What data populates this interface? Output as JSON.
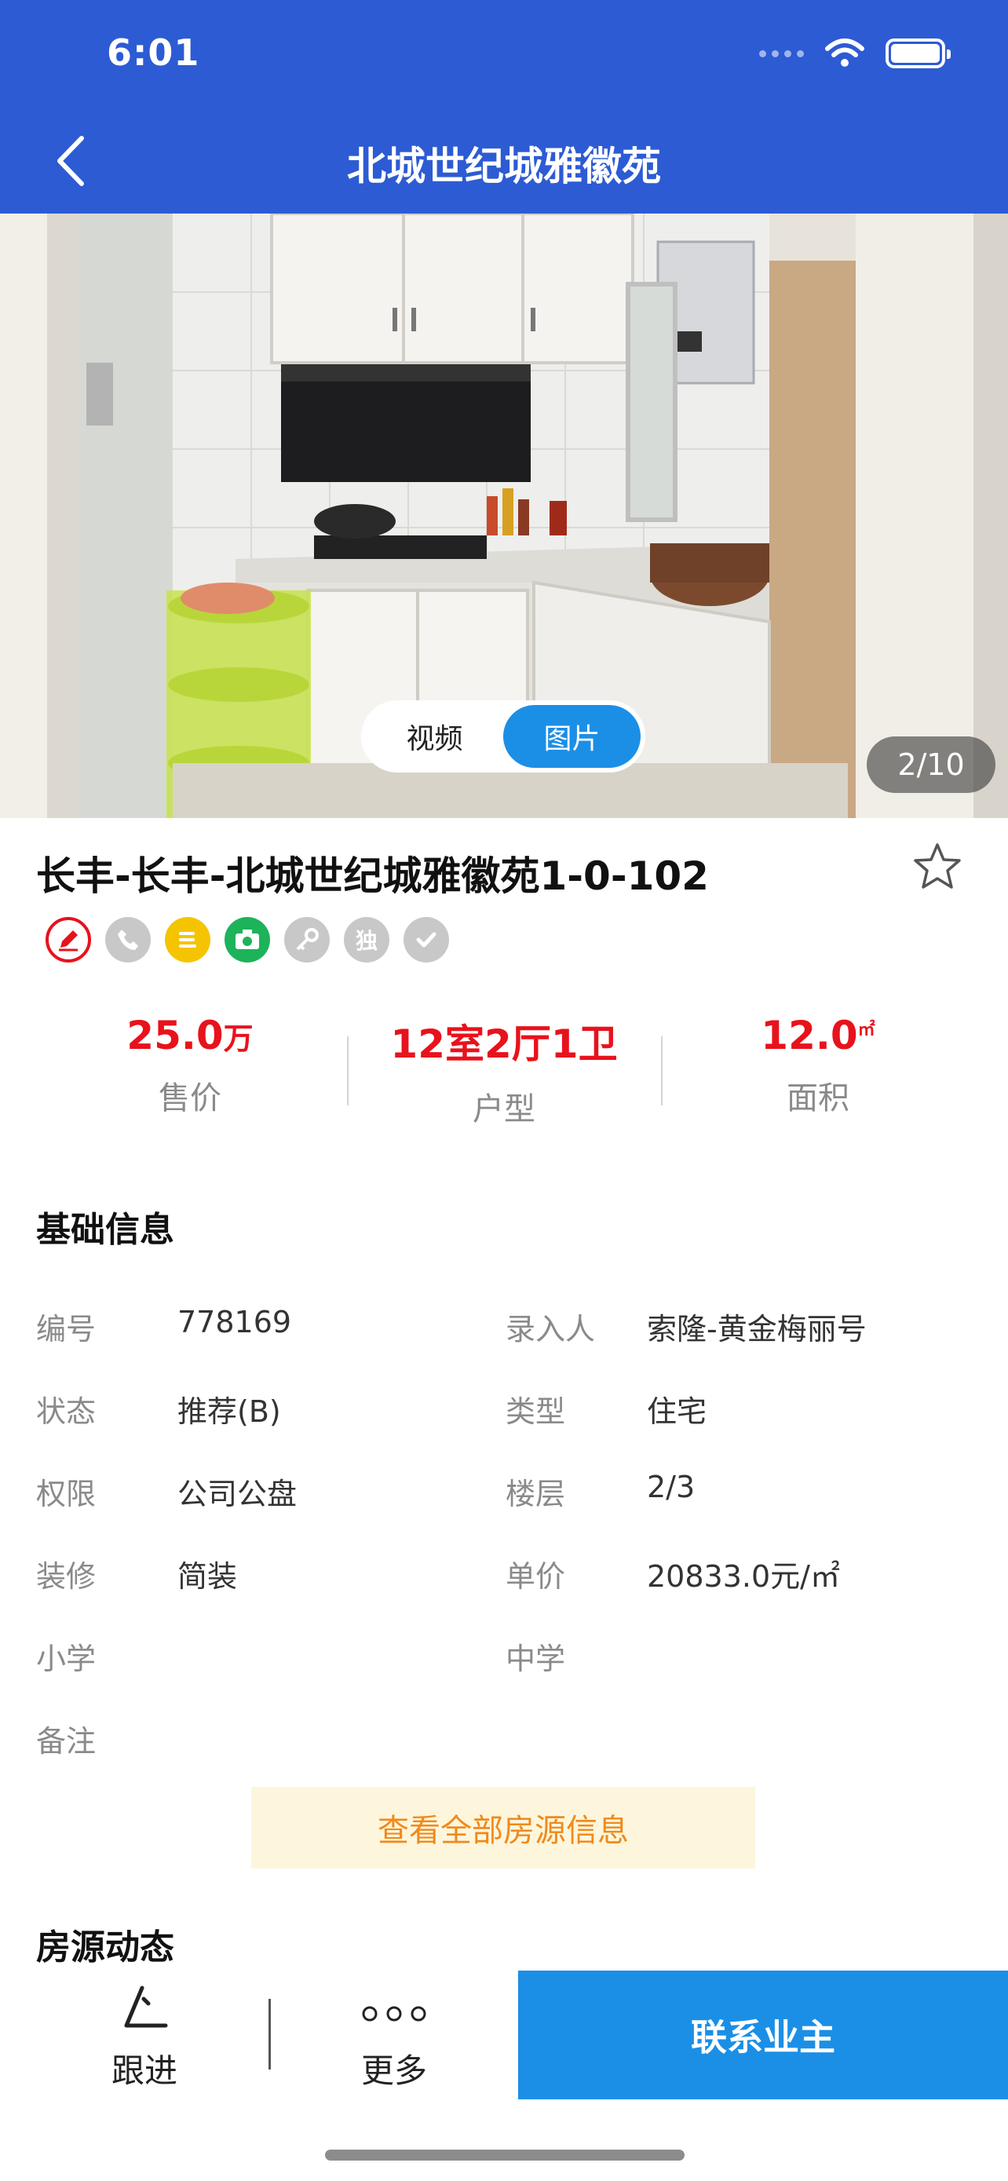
{
  "status_bar": {
    "time": "6:01"
  },
  "header": {
    "title": "北城世纪城雅徽苑"
  },
  "gallery": {
    "toggle_video": "视频",
    "toggle_photo": "图片",
    "counter": "2/10"
  },
  "listing": {
    "title": "长丰-长丰-北城世纪城雅徽苑1-0-102",
    "tags": [
      {
        "icon": "edit-icon",
        "color": "#e8121c"
      },
      {
        "icon": "phone-icon",
        "color": "#c8c8c8"
      },
      {
        "icon": "cash-icon",
        "color": "#f5c400"
      },
      {
        "icon": "camera-icon",
        "color": "#1db35a"
      },
      {
        "icon": "key-icon",
        "color": "#c8c8c8"
      },
      {
        "icon": "exclusive-icon",
        "label": "独",
        "color": "#c8c8c8"
      },
      {
        "icon": "check-icon",
        "color": "#c8c8c8"
      }
    ]
  },
  "stats": {
    "price_value": "25.0",
    "price_unit": "万",
    "price_label": "售价",
    "layout_value": "12室2厅1卫",
    "layout_label": "户型",
    "area_value": "12.0",
    "area_unit": "㎡",
    "area_label": "面积"
  },
  "basic_info": {
    "title": "基础信息",
    "left": [
      {
        "label": "编号",
        "value": "778169"
      },
      {
        "label": "状态",
        "value": "推荐(B)"
      },
      {
        "label": "权限",
        "value": "公司公盘"
      },
      {
        "label": "装修",
        "value": "简装"
      },
      {
        "label": "小学",
        "value": ""
      },
      {
        "label": "备注",
        "value": ""
      }
    ],
    "right": [
      {
        "label": "录入人",
        "value": "索隆-黄金梅丽号"
      },
      {
        "label": "类型",
        "value": "住宅"
      },
      {
        "label": "楼层",
        "value": "2/3"
      },
      {
        "label": "单价",
        "value": "20833.0元/㎡"
      },
      {
        "label": "中学",
        "value": ""
      }
    ],
    "view_all": "查看全部房源信息"
  },
  "dynamics": {
    "title": "房源动态"
  },
  "bottom_bar": {
    "follow_up": "跟进",
    "more": "更多",
    "contact": "联系业主"
  },
  "colors": {
    "header_bg": "#2d5bd3",
    "accent_blue": "#1b8fe6",
    "price_red": "#e8121c",
    "highlight_orange": "#f08a1c"
  }
}
